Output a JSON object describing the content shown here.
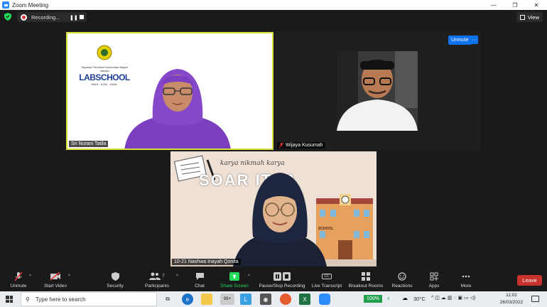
{
  "window": {
    "title": "Zoom Meeting"
  },
  "topbar": {
    "recording_label": "Recording...",
    "view_label": "View"
  },
  "participants": [
    {
      "name": "Sri Nurani Tatila"
    },
    {
      "name": "Wijaya Kusumah"
    },
    {
      "name": "10-21 Nashwa Inayah Qonita"
    }
  ],
  "tile_controls": {
    "unmute_label": "Unmute",
    "more_label": "···"
  },
  "labschool_logo": {
    "org": "Yayasan Pembina Universitas Negeri Jakarta",
    "brand": "LABSCHOOL",
    "motto": "IMAN - ILMU - AMAL"
  },
  "virtual_bg": {
    "script_text": "karya nikmah karya",
    "title_text": "SOAR  ITRA",
    "building_sign": "SCHOOL"
  },
  "toolbar": {
    "unmute": "Unmute",
    "start_video": "Start Video",
    "security": "Security",
    "participants": "Participants",
    "participants_count": "7",
    "chat": "Chat",
    "share_screen": "Share Screen",
    "pause_stop_recording": "Pause/Stop Recording",
    "live_transcript": "Live Transcript",
    "cc_label": "CC",
    "breakout_rooms": "Breakout Rooms",
    "reactions": "Reactions",
    "apps": "Apps",
    "more": "More",
    "leave": "Leave"
  },
  "taskbar": {
    "search_placeholder": "Type here to search",
    "store_badge": "99+",
    "battery": "100%",
    "temperature": "30°C",
    "time": "11:02",
    "date": "26/03/2022"
  },
  "colors": {
    "accent_blue": "#0e72ed",
    "leave_red": "#c8312d",
    "share_green": "#23d959",
    "active_speaker": "#d7e03a"
  }
}
